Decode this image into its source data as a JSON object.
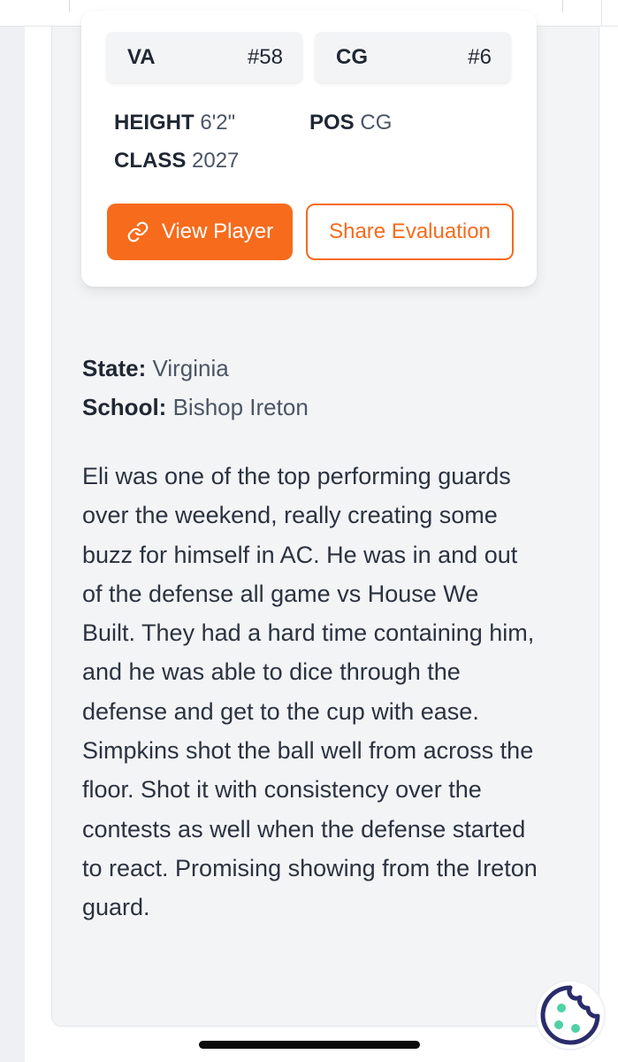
{
  "card": {
    "state_chip": {
      "label": "VA",
      "number": "#58"
    },
    "pos_chip": {
      "label": "CG",
      "number": "#6"
    },
    "height": {
      "label": "HEIGHT",
      "value": "6'2\""
    },
    "pos": {
      "label": "POS",
      "value": "CG"
    },
    "class": {
      "label": "CLASS",
      "value": "2027"
    },
    "view_button": {
      "label": "View Player",
      "icon": "link-icon"
    },
    "share_button": {
      "label": "Share Evaluation"
    }
  },
  "meta": {
    "state": {
      "label": "State:",
      "value": "Virginia"
    },
    "school": {
      "label": "School:",
      "value": "Bishop Ireton"
    }
  },
  "evaluation_text": "Eli was one of the top performing guards over the weekend, really creating some buzz for himself in AC. He was in and out of the defense all game vs House We Built. They had a hard time containing him, and he was able to dice through the defense and get to the cup with ease. Simpkins shot the ball well from across the floor. Shot it with consistency over the contests as well when the defense started to react. Promising showing from the Ireton guard.",
  "colors": {
    "accent": "#f76b1c",
    "panel_bg": "#f3f4f6",
    "text": "#1f2733",
    "cookie": "#2a2c6b",
    "cookie_dots": "#4fd1a5"
  },
  "widgets": {
    "cookie_icon": "cookie-icon",
    "home_indicator": "home-indicator"
  }
}
